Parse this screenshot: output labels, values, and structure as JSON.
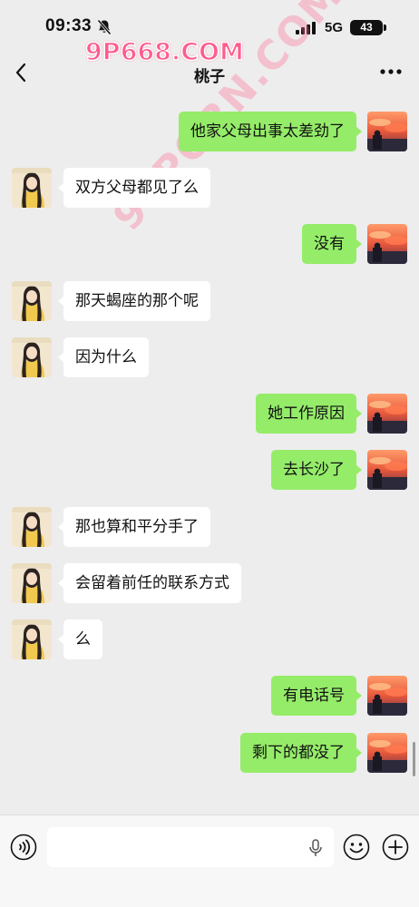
{
  "status_bar": {
    "time": "09:33",
    "network": "5G",
    "battery": "43",
    "icons": [
      "bell-muted-icon",
      "signal-icon",
      "battery-icon"
    ]
  },
  "watermark": {
    "top_text": "9P668.COM",
    "diagonal_text": "91PORN.COM"
  },
  "header": {
    "title": "桃子",
    "back_icon": "chevron-left-icon",
    "more_icon": "more-dots-icon"
  },
  "messages": [
    {
      "side": "right",
      "text": "他家父母出事太差劲了"
    },
    {
      "side": "left",
      "text": "双方父母都见了么"
    },
    {
      "side": "right",
      "text": "没有"
    },
    {
      "side": "left",
      "text": "那天蝎座的那个呢"
    },
    {
      "side": "left",
      "text": "因为什么"
    },
    {
      "side": "right",
      "text": "她工作原因"
    },
    {
      "side": "right",
      "text": "去长沙了"
    },
    {
      "side": "left",
      "text": "那也算和平分手了"
    },
    {
      "side": "left",
      "text": "会留着前任的联系方式"
    },
    {
      "side": "left",
      "text": "么"
    },
    {
      "side": "right",
      "text": "有电话号"
    },
    {
      "side": "right",
      "text": "剩下的都没了"
    }
  ],
  "input_bar": {
    "placeholder": "",
    "icons": [
      "voice-icon",
      "mic-icon",
      "emoji-icon",
      "plus-icon"
    ]
  },
  "colors": {
    "background": "#ededed",
    "sent_bubble": "#95ec69",
    "received_bubble": "#ffffff",
    "watermark": "#ff5c8d"
  }
}
